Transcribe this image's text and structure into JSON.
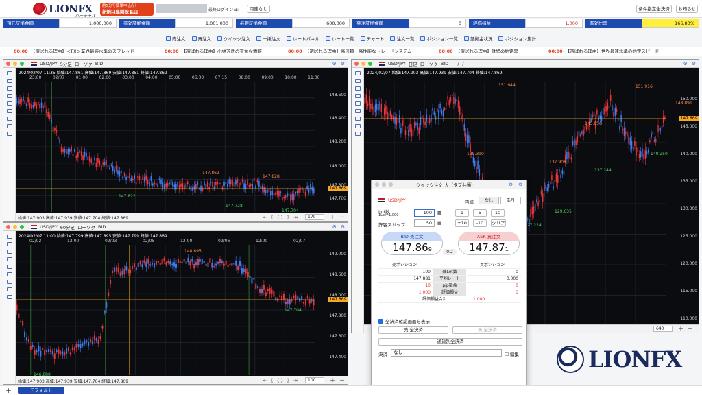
{
  "header": {
    "logo": "LIONFX",
    "logo_sub": "バーチャル",
    "promo_line1": "約5分で簡単申込み！",
    "promo_line2": "新規口座開設",
    "promo_badge": "無料",
    "last_login": "最終ログイン日:",
    "hedge": "両建なし",
    "cond_close": "条件指定全決済",
    "notice": "お知らせ"
  },
  "summary": [
    {
      "label": "預託証拠金額",
      "value": "1,000,000"
    },
    {
      "label": "有効証拠金額",
      "value": "1,001,000"
    },
    {
      "label": "必要証拠金額",
      "value": "600,000"
    },
    {
      "label": "発注証拠金額",
      "value": "0"
    },
    {
      "label": "評価損益",
      "value": "1,000"
    },
    {
      "label": "有効比率",
      "value": "166.83%"
    }
  ],
  "toolbar": [
    "売注文",
    "買注文",
    "クイック注文",
    "一括注文",
    "レートパネル",
    "レート一覧",
    "チャート",
    "注文一覧",
    "ポジション一覧",
    "証拠金状況",
    "ポジション集計"
  ],
  "ticker": [
    {
      "time": "00:00",
      "text": "【選ばれる理由】＜FX＞業界最狭水準のスプレッド"
    },
    {
      "time": "00:00",
      "text": "【選ばれる理由】小林芳彦の有益な情報"
    },
    {
      "time": "00:00",
      "text": "【選ばれる理由】高信頼・高性能なトレードシステム"
    },
    {
      "time": "00:00",
      "text": "【選ばれる理由】鉄壁の約定率"
    },
    {
      "time": "00:00",
      "text": "【選ばれる理由】世界最速水準の約定スピード"
    }
  ],
  "charts": {
    "c1": {
      "pair": "USD/JPY",
      "tf": "5分足",
      "type": "ローソク",
      "side": "BID",
      "info": "2024/02/07 11:35  始値:147.861  高値:147.869  安値:147.851  終値:147.869",
      "times": [
        "23:00",
        "02/07",
        "01:00",
        "02:00",
        "03:00",
        "04:00",
        "05:00",
        "06:00",
        "07:15",
        "08:00",
        "09:00",
        "10:00",
        "11:00"
      ],
      "axis": [
        "148.600",
        "148.400",
        "148.200",
        "148.000",
        "147.800",
        "147.700"
      ],
      "current": "147.869",
      "hi_label": "147.862",
      "hi2_label": "147.828",
      "lo_label": "147.822",
      "lo2_label": "147.728",
      "lo3_label": "147.704",
      "foot": "始値:147.903  高値:147.939  安値:147.704  終値:147.869",
      "count": "170"
    },
    "c2": {
      "pair": "USD/JPY",
      "tf": "60分足",
      "type": "ローソク",
      "side": "BID",
      "info": "2024/02/07 11:00  始値:147.799  高値:147.895  安値:147.799  終値:147.869",
      "times": [
        "02/02",
        "12:00",
        "02/03",
        "02/05",
        "12:00",
        "02/06",
        "12:00",
        "02/07"
      ],
      "axis": [
        "149.000",
        "148.600",
        "148.000",
        "147.800",
        "147.600",
        "147.400"
      ],
      "current": "147.869",
      "hi_label": "148.895",
      "lo_label": "147.704",
      "lo2_label": "146.880",
      "foot": "始値:147.903  高値:147.939  安値:147.704  終値:147.869",
      "count": "100"
    },
    "c3": {
      "pair": "USD/JPY",
      "tf": "日足",
      "type": "ローソク",
      "side": "BID",
      "extra": "----/--/--",
      "info": "2024/02/07  始値:147.903  高値:147.939  安値:147.704  終値:147.869",
      "axis": [
        "150.000",
        "145.000",
        "140.000",
        "135.000",
        "130.000",
        "125.000",
        "120.000",
        "115.000",
        "110.000"
      ],
      "current": "147.869",
      "labels": [
        "151.944",
        "151.916",
        "148.891",
        "145.056",
        "139.390",
        "137.906",
        "137.244",
        "140.250",
        "129.635",
        "127.224"
      ],
      "count": "640"
    }
  },
  "quick": {
    "title": "クイック注文 大（タブ共通）",
    "pair": "USD/JPY",
    "hedge_label": "両建",
    "hedge_off": "なし",
    "hedge_on": "あり",
    "lot_label": "Lot数",
    "lot_sub": "1Lot=1,000",
    "lot_value": "100",
    "slip_label": "許容スリップ",
    "slip_value": "50",
    "steps": [
      "1",
      "5",
      "10",
      "+10",
      "-10",
      "クリア"
    ],
    "bid_label": "BID 売注文",
    "bid_main": "147.86",
    "bid_last": "9",
    "ask_label": "ASK 買注文",
    "ask_main": "147.87",
    "ask_last": "1",
    "spread": "0.2",
    "sell_head": "売ポジション",
    "buy_head": "買ポジション",
    "rows": [
      {
        "l": "100",
        "m": "残Lot数",
        "r": "0"
      },
      {
        "l": "147.881",
        "m": "平均レート",
        "r": "0.000"
      },
      {
        "l": "10",
        "m": "pip損益",
        "r": "0"
      },
      {
        "l": "1,000",
        "m": "評価損益",
        "r": "0"
      }
    ],
    "total_label": "評価損益合計",
    "total_value": "1,000",
    "confirm": "全決済確認画面を表示",
    "sell_close": "売 全決済",
    "buy_close": "買 全決済",
    "pair_close": "通貨別全決済",
    "settle_label": "決済",
    "settle_value": "なし",
    "edit": "編集"
  },
  "footer": {
    "tab": "デフォルト"
  },
  "brand": "LIONFX"
}
